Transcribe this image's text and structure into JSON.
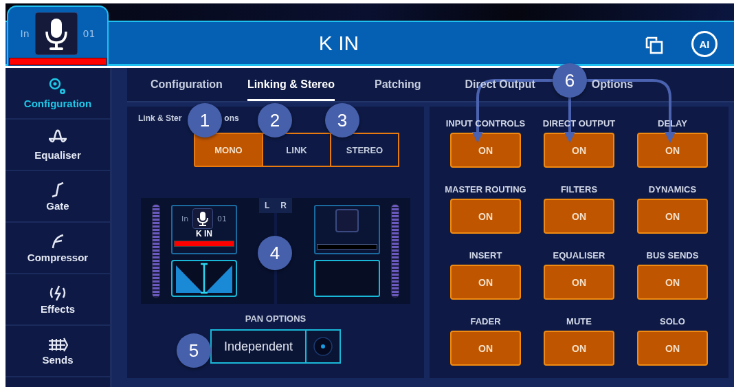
{
  "header": {
    "prefix": "In",
    "number": "01",
    "title": "K IN",
    "ai_label": "AI"
  },
  "sidebar": {
    "items": [
      {
        "label": "Configuration",
        "kind": "config",
        "selected": true
      },
      {
        "label": "Equaliser",
        "kind": "eq",
        "selected": false
      },
      {
        "label": "Gate",
        "kind": "gate",
        "selected": false
      },
      {
        "label": "Compressor",
        "kind": "comp",
        "selected": false
      },
      {
        "label": "Effects",
        "kind": "fx",
        "selected": false
      },
      {
        "label": "Sends",
        "kind": "sends",
        "selected": false
      }
    ]
  },
  "tabs": [
    {
      "label": "Configuration",
      "selected": false
    },
    {
      "label": "Linking & Stereo",
      "selected": true
    },
    {
      "label": "Patching",
      "selected": false
    },
    {
      "label": "Direct Output",
      "selected": false
    },
    {
      "label": "Options",
      "selected": false
    }
  ],
  "link_stereo": {
    "label_start": "Link & Ster",
    "label_end": "ons",
    "modes": [
      {
        "label": "MONO",
        "selected": true
      },
      {
        "label": "LINK",
        "selected": false
      },
      {
        "label": "STEREO",
        "selected": false
      }
    ]
  },
  "stereo_view": {
    "left_label": "L",
    "right_label": "R",
    "channel": {
      "prefix": "In",
      "number": "01",
      "name": "K IN"
    }
  },
  "pan_options": {
    "label": "PAN OPTIONS",
    "value": "Independent"
  },
  "controls": [
    {
      "label": "INPUT CONTROLS",
      "value": "ON",
      "on": true
    },
    {
      "label": "DIRECT OUTPUT",
      "value": "ON",
      "on": true
    },
    {
      "label": "DELAY",
      "value": "ON",
      "on": true
    },
    {
      "label": "MASTER ROUTING",
      "value": "ON",
      "on": true
    },
    {
      "label": "FILTERS",
      "value": "ON",
      "on": true
    },
    {
      "label": "DYNAMICS",
      "value": "ON",
      "on": true
    },
    {
      "label": "INSERT",
      "value": "ON",
      "on": true
    },
    {
      "label": "EQUALISER",
      "value": "ON",
      "on": true
    },
    {
      "label": "BUS SENDS",
      "value": "ON",
      "on": true
    },
    {
      "label": "FADER",
      "value": "ON",
      "on": true
    },
    {
      "label": "MUTE",
      "value": "ON",
      "on": true
    },
    {
      "label": "SOLO",
      "value": "ON",
      "on": true
    }
  ],
  "callouts": [
    "1",
    "2",
    "3",
    "4",
    "5",
    "6"
  ]
}
